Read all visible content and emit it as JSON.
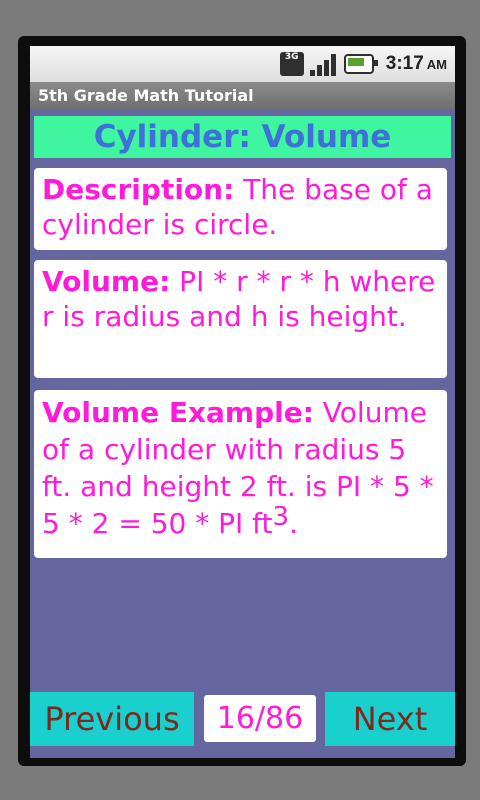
{
  "status_bar": {
    "network_label": "3G",
    "time": "3:17",
    "ampm": "AM"
  },
  "app": {
    "title": "5th Grade Math Tutorial"
  },
  "lesson": {
    "header": "Cylinder: Volume",
    "description_label": "Description:",
    "description_text": " The base of a cylinder is circle.",
    "volume_label": "Volume:",
    "volume_text": " PI * r * r * h where r is radius and h is height.",
    "example_label": "Volume Example:",
    "example_text": " Volume of a cylinder with radius 5 ft. and height 2 ft. is PI * 5 * 5 * 2 = 50 * PI ft",
    "example_exponent": "3",
    "example_end": "."
  },
  "navigation": {
    "previous_label": "Previous",
    "page_indicator": "16/86",
    "next_label": "Next"
  },
  "colors": {
    "header_bg": "#3ff5a0",
    "header_text": "#3f6fd8",
    "body_text": "#ff1bd8",
    "screen_bg": "#6566a0",
    "button_bg": "#1ccfcf",
    "button_text": "#7a2b1e"
  },
  "icons": [
    "network-3g-icon",
    "signal-strength-icon",
    "battery-icon"
  ]
}
